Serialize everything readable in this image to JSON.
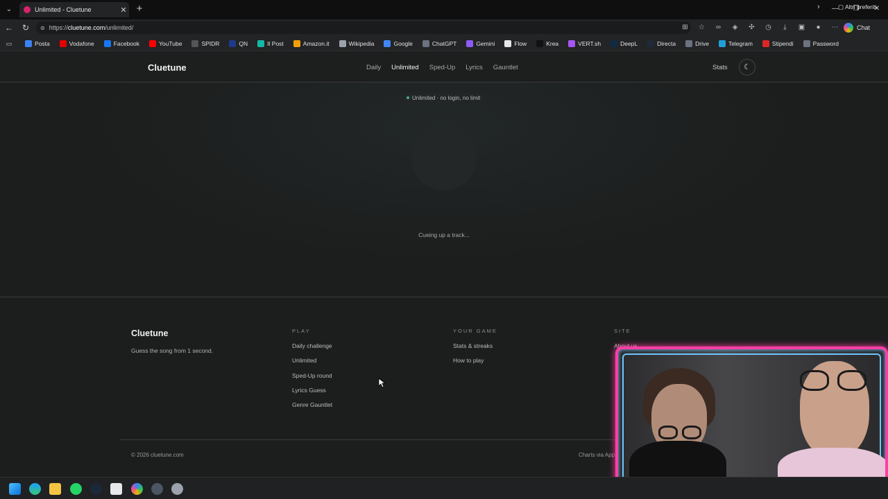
{
  "browser": {
    "tab_title": "Unlimited - Cluetune",
    "url_prefix": "https://",
    "url_host": "cluetune.com",
    "url_path": "/unlimited/",
    "chat_label": "Chat",
    "bookmarks": [
      {
        "label": "Posta",
        "color": "#3b82f6",
        "icon": "mail-icon"
      },
      {
        "label": "Vodafone",
        "color": "#e60000",
        "icon": "vodafone-icon"
      },
      {
        "label": "Facebook",
        "color": "#1877f2",
        "icon": "facebook-icon"
      },
      {
        "label": "YouTube",
        "color": "#ff0000",
        "icon": "youtube-icon"
      },
      {
        "label": "SPIDR",
        "color": "#555555",
        "icon": "spidr-icon"
      },
      {
        "label": "QN",
        "color": "#1e3a8a",
        "icon": "qn-icon"
      },
      {
        "label": "Il Post",
        "color": "#14b8a6",
        "icon": "ilpost-icon"
      },
      {
        "label": "Amazon.it",
        "color": "#f59e0b",
        "icon": "amazon-icon"
      },
      {
        "label": "Wikipedia",
        "color": "#9ca3af",
        "icon": "wikipedia-icon"
      },
      {
        "label": "Google",
        "color": "#4285f4",
        "icon": "google-icon"
      },
      {
        "label": "ChatGPT",
        "color": "#6b7280",
        "icon": "chatgpt-icon"
      },
      {
        "label": "Gemini",
        "color": "#8b5cf6",
        "icon": "gemini-icon"
      },
      {
        "label": "Flow",
        "color": "#e5e7eb",
        "icon": "flow-icon"
      },
      {
        "label": "Krea",
        "color": "#111111",
        "icon": "krea-icon"
      },
      {
        "label": "VERT.sh",
        "color": "#a855f7",
        "icon": "vert-icon"
      },
      {
        "label": "DeepL",
        "color": "#0f2b46",
        "icon": "deepl-icon"
      },
      {
        "label": "Directa",
        "color": "#1f2937",
        "icon": "directa-icon"
      },
      {
        "label": "Drive",
        "color": "#6b7280",
        "icon": "drive-icon"
      },
      {
        "label": "Telegram",
        "color": "#229ed9",
        "icon": "telegram-icon"
      },
      {
        "label": "Stipendi",
        "color": "#dc2626",
        "icon": "stipendi-icon"
      },
      {
        "label": "Password",
        "color": "#6b7280",
        "icon": "password-icon"
      }
    ],
    "other_bookmarks": "Altri preferiti"
  },
  "site": {
    "brand": "Cluetune",
    "nav": [
      "Daily",
      "Unlimited",
      "Sped-Up",
      "Lyrics",
      "Gauntlet"
    ],
    "nav_active_index": 1,
    "stats": "Stats",
    "status_pill": "Unlimited · no login, no limit",
    "loading_text": "Cueing up a track...",
    "footer": {
      "brand": "Cluetune",
      "tagline": "Guess the song from 1 second.",
      "play_heading": "PLAY",
      "play_links": [
        "Daily challenge",
        "Unlimited",
        "Sped-Up round",
        "Lyrics Guess",
        "Genre Gauntlet"
      ],
      "game_heading": "YOUR GAME",
      "game_links": [
        "Stats & streaks",
        "How to play"
      ],
      "site_heading": "SITE",
      "site_links": [
        "About us"
      ],
      "copyright": "© 2026 cluetune.com",
      "charts_via": "Charts via App"
    }
  },
  "colors": {
    "accent_green": "#3fb27f",
    "webcam_border": "#ff3ea5",
    "webcam_inner": "#6ec7ff"
  }
}
